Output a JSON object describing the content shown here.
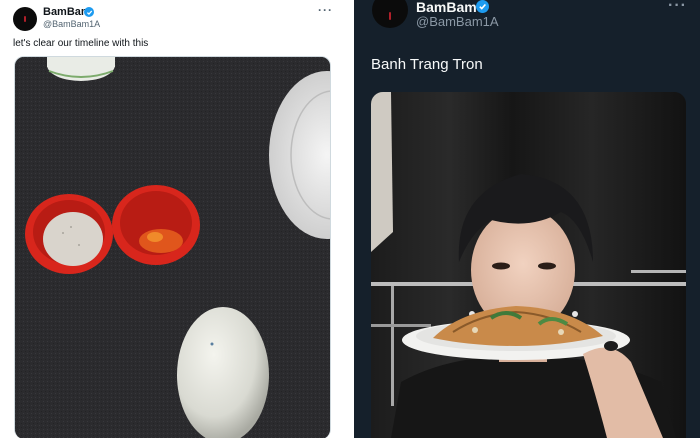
{
  "left_tweet": {
    "display_name": "BamBam",
    "handle": "@BamBam1A",
    "more_icon": "more-horizontal-icon",
    "verified_icon": "verified-badge-icon",
    "text": "let's clear our timeline with this",
    "media_description": "two small red bowls with salt and chili, a white egg on dark fabric"
  },
  "right_tweet": {
    "display_name": "BamBam",
    "handle": "@BamBam1A",
    "more_icon": "more-horizontal-icon",
    "verified_icon": "verified-badge-icon",
    "text": "Banh Trang Tron",
    "media_description": "person holding a plate of banh trang tron in front of a black curtain"
  },
  "colors": {
    "verified": "#1d9bf0",
    "dark_background": "#15202b",
    "light_background": "#ffffff"
  }
}
